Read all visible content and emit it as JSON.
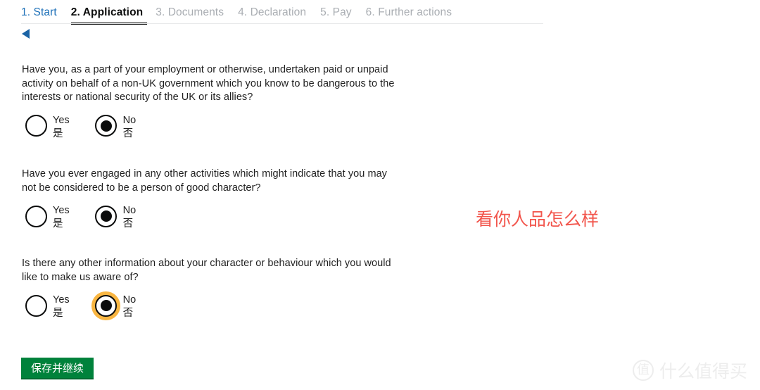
{
  "step_nav": {
    "steps": [
      {
        "label": "1. Start",
        "state": "link"
      },
      {
        "label": "2. Application",
        "state": "current"
      },
      {
        "label": "3. Documents",
        "state": "muted"
      },
      {
        "label": "4. Declaration",
        "state": "muted"
      },
      {
        "label": "5. Pay",
        "state": "muted"
      },
      {
        "label": "6. Further actions",
        "state": "muted"
      }
    ]
  },
  "back": {
    "icon": "back-triangle-icon"
  },
  "questions": [
    {
      "text": "Have you, as a part of your employment or otherwise, undertaken paid or unpaid activity on behalf of a non-UK government which you know to be dangerous to the interests or national security of the UK or its allies?",
      "options": [
        {
          "en": "Yes",
          "cn": "是",
          "checked": false,
          "focused": false
        },
        {
          "en": "No",
          "cn": "否",
          "checked": true,
          "focused": false
        }
      ]
    },
    {
      "text": "Have you ever engaged in any other activities which might indicate that you may not be considered to be a person of good character?",
      "options": [
        {
          "en": "Yes",
          "cn": "是",
          "checked": false,
          "focused": false
        },
        {
          "en": "No",
          "cn": "否",
          "checked": true,
          "focused": false
        }
      ]
    },
    {
      "text": "Is there any other information about your character or behaviour which you would like to make us aware of?",
      "options": [
        {
          "en": "Yes",
          "cn": "是",
          "checked": false,
          "focused": false
        },
        {
          "en": "No",
          "cn": "否",
          "checked": true,
          "focused": true
        }
      ]
    }
  ],
  "annotation": {
    "text": "看你人品怎么样",
    "color": "#f2554c"
  },
  "submit": {
    "label": "保存并继续",
    "color": "#00823b"
  },
  "watermark": {
    "badge": "值",
    "text": "什么值得买"
  }
}
